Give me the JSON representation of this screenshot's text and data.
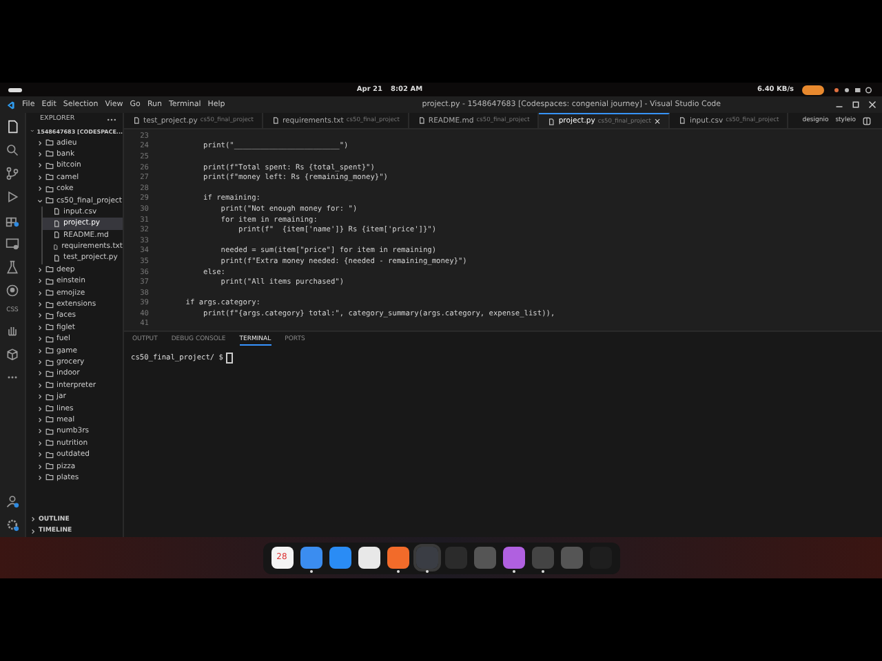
{
  "os_bar": {
    "date": "Apr 21",
    "time": "8:02 AM",
    "net_speed": "6.40 KB/s"
  },
  "window": {
    "title": "project.py - 1548647683 [Codespaces: congenial journey] - Visual Studio Code"
  },
  "menu": [
    "File",
    "Edit",
    "Selection",
    "View",
    "Go",
    "Run",
    "Terminal",
    "Help"
  ],
  "activity_bar": {
    "css_label": "CSS"
  },
  "explorer": {
    "header": "EXPLORER",
    "root": "1548647683 [CODESPACE...",
    "items": [
      {
        "name": "adieu",
        "folder": true,
        "expanded": false,
        "selected": false
      },
      {
        "name": "bank",
        "folder": true,
        "expanded": false,
        "selected": false
      },
      {
        "name": "bitcoin",
        "folder": true,
        "expanded": false,
        "selected": false
      },
      {
        "name": "camel",
        "folder": true,
        "expanded": false,
        "selected": false
      },
      {
        "name": "coke",
        "folder": true,
        "expanded": false,
        "selected": false
      },
      {
        "name": "cs50_final_project",
        "folder": true,
        "expanded": true,
        "selected": false,
        "children": [
          {
            "name": "input.csv",
            "folder": false,
            "selected": false
          },
          {
            "name": "project.py",
            "folder": false,
            "selected": true
          },
          {
            "name": "README.md",
            "folder": false,
            "selected": false
          },
          {
            "name": "requirements.txt",
            "folder": false,
            "selected": false
          },
          {
            "name": "test_project.py",
            "folder": false,
            "selected": false
          }
        ]
      },
      {
        "name": "deep",
        "folder": true,
        "expanded": false,
        "selected": false
      },
      {
        "name": "einstein",
        "folder": true,
        "expanded": false,
        "selected": false
      },
      {
        "name": "emojize",
        "folder": true,
        "expanded": false,
        "selected": false
      },
      {
        "name": "extensions",
        "folder": true,
        "expanded": false,
        "selected": false
      },
      {
        "name": "faces",
        "folder": true,
        "expanded": false,
        "selected": false
      },
      {
        "name": "figlet",
        "folder": true,
        "expanded": false,
        "selected": false
      },
      {
        "name": "fuel",
        "folder": true,
        "expanded": false,
        "selected": false
      },
      {
        "name": "game",
        "folder": true,
        "expanded": false,
        "selected": false
      },
      {
        "name": "grocery",
        "folder": true,
        "expanded": false,
        "selected": false
      },
      {
        "name": "indoor",
        "folder": true,
        "expanded": false,
        "selected": false
      },
      {
        "name": "interpreter",
        "folder": true,
        "expanded": false,
        "selected": false
      },
      {
        "name": "jar",
        "folder": true,
        "expanded": false,
        "selected": false
      },
      {
        "name": "lines",
        "folder": true,
        "expanded": false,
        "selected": false
      },
      {
        "name": "meal",
        "folder": true,
        "expanded": false,
        "selected": false
      },
      {
        "name": "numb3rs",
        "folder": true,
        "expanded": false,
        "selected": false
      },
      {
        "name": "nutrition",
        "folder": true,
        "expanded": false,
        "selected": false
      },
      {
        "name": "outdated",
        "folder": true,
        "expanded": false,
        "selected": false
      },
      {
        "name": "pizza",
        "folder": true,
        "expanded": false,
        "selected": false
      },
      {
        "name": "plates",
        "folder": true,
        "expanded": false,
        "selected": false
      }
    ],
    "sections": [
      "OUTLINE",
      "TIMELINE"
    ]
  },
  "tabs": [
    {
      "label": "test_project.py",
      "folder": "cs50_final_project",
      "selected": false
    },
    {
      "label": "requirements.txt",
      "folder": "cs50_final_project",
      "selected": false
    },
    {
      "label": "README.md",
      "folder": "cs50_final_project",
      "selected": false
    },
    {
      "label": "project.py",
      "folder": "cs50_final_project",
      "selected": true
    },
    {
      "label": "input.csv",
      "folder": "cs50_final_project",
      "selected": false
    }
  ],
  "tab_actions": [
    "designio",
    "styleio"
  ],
  "close_glyph": "×",
  "code_lines": [
    {
      "number": "23"
    },
    {
      "number": "24",
      "text": "        print(\"________________________\")"
    },
    {
      "number": "25"
    },
    {
      "number": "26",
      "text": "        print(f\"Total spent: Rs {total_spent}\")"
    },
    {
      "number": "27",
      "text": "        print(f\"money left: Rs {remaining_money}\")"
    },
    {
      "number": "28"
    },
    {
      "number": "29",
      "text": "        if remaining:"
    },
    {
      "number": "30",
      "text": "            print(\"Not enough money for: \")"
    },
    {
      "number": "31",
      "text": "            for item in remaining:"
    },
    {
      "number": "32",
      "text": "                print(f\"  {item['name']} Rs {item['price']}\")"
    },
    {
      "number": "33"
    },
    {
      "number": "34",
      "text": "            needed = sum(item[\"price\"] for item in remaining)"
    },
    {
      "number": "35",
      "text": "            print(f\"Extra money needed: {needed - remaining_money}\")"
    },
    {
      "number": "36",
      "text": "        else:"
    },
    {
      "number": "37",
      "text": "            print(\"All items purchased\")"
    },
    {
      "number": "38"
    },
    {
      "number": "39",
      "text": "    if args.category:"
    },
    {
      "number": "40",
      "text": "        print(f\"{args.category} total:\", category_summary(args.category, expense_list)),"
    },
    {
      "number": "41"
    }
  ],
  "panel": {
    "tabs": [
      {
        "label": "OUTPUT",
        "selected": false
      },
      {
        "label": "DEBUG CONSOLE",
        "selected": false
      },
      {
        "label": "TERMINAL",
        "selected": true
      },
      {
        "label": "PORTS",
        "selected": false
      }
    ],
    "prompt": "cs50_final_project/ $"
  },
  "dock": [
    {
      "running": false,
      "label": "28"
    },
    {
      "running": true
    },
    {
      "running": false
    },
    {
      "running": false
    },
    {
      "running": true
    },
    {
      "running": true
    },
    {
      "running": false
    },
    {
      "running": false
    },
    {
      "running": true
    },
    {
      "running": true
    },
    {
      "running": false
    },
    {
      "running": false
    }
  ]
}
